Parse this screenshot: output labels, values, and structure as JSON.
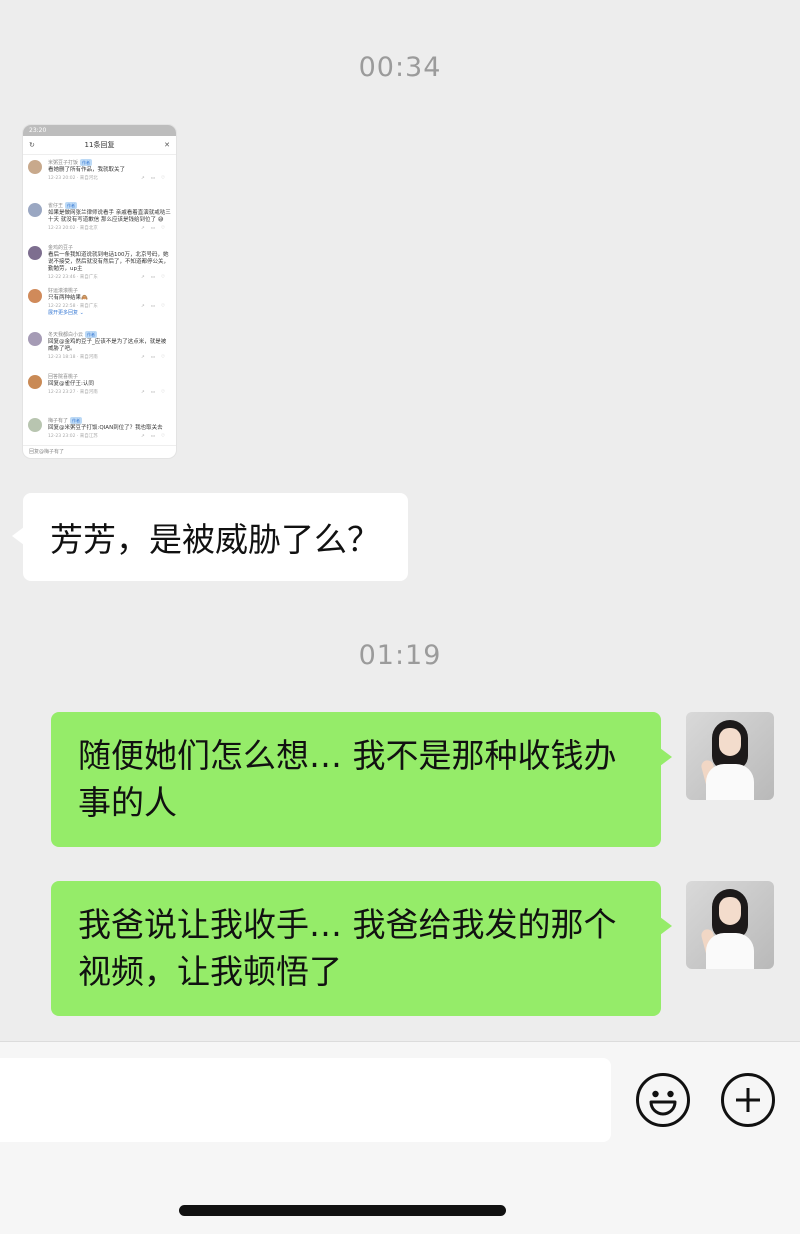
{
  "chat": {
    "timestamps": [
      "00:34",
      "01:19"
    ],
    "screenshot": {
      "status_time": "23:20",
      "title": "11条回复",
      "comments": [
        {
          "name": "米粥豆子打饭",
          "tag": "作者",
          "text": "看她删了所有作品，我就取关了",
          "meta": "12-23 20:02 · 来自河北"
        },
        {
          "name": "雀仔王",
          "tag": "作者",
          "text": "如果是做网张兰律师说看手 亲戚看着直演就戒哒三十天 就没有写道歉信 那么应该是钱给到位了 😅",
          "meta": "12-23 20:02 · 来自北京"
        },
        {
          "name": "金鸡的豆子",
          "tag": "",
          "text": "看后一条我知道说就到电话100万，北京号码，她说不接受，然后就没有然后了，不知道都停公关，勤勉劳，up主",
          "meta": "12-22 23:46 · 来自广东"
        },
        {
          "name": "好运滚滚桃子",
          "tag": "",
          "text": "只有两种结果🙈",
          "meta": "12-22 22:58 · 来自广东"
        },
        {
          "name": "冬天我都白小云",
          "tag": "作者",
          "text": "回复@金鸡的豆子_应该不是为了这点米，就是被威胁了吧。",
          "meta": "12-23 18:18 · 来自河南"
        },
        {
          "name": "回答院喜桃子",
          "tag": "",
          "text": "回复@雀仔王:认同",
          "meta": "12-23 23:27 · 来自河南"
        },
        {
          "name": "梅子有了",
          "tag": "作者",
          "text": "回复@米粥豆子打饭:QIAN到位了？我也取关去",
          "meta": "12-23 23:02 · 来自江苏"
        }
      ],
      "more_replies": "展开更多回复 ⌄",
      "footer": "回复@梅子有了"
    },
    "messages": [
      {
        "text": "芳芳，是被威胁了么？"
      },
      {
        "text": "随便她们怎么想… 我不是那种收钱办事的人"
      },
      {
        "text": "我爸说让我收手… 我爸给我发的那个视频，让我顿悟了"
      }
    ]
  },
  "input_bar": {
    "emoji_icon": "smiley-icon",
    "plus_icon": "plus-circle-icon"
  }
}
